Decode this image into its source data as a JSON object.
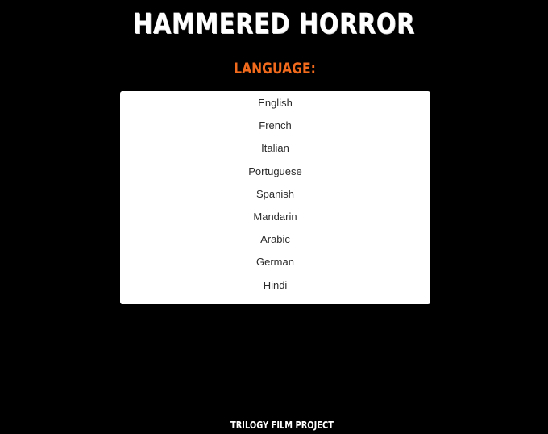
{
  "header": {
    "title": "Hammered Horror"
  },
  "language_section": {
    "label": "Language:",
    "options": [
      "English",
      "French",
      "Italian",
      "Portuguese",
      "Spanish",
      "Mandarin",
      "Arabic",
      "German",
      "Hindi"
    ]
  },
  "footer": {
    "text": "Trilogy Film Project"
  },
  "colors": {
    "background": "#000000",
    "accent": "#f26b1d",
    "title": "#ffffff",
    "list_background": "#ffffff"
  }
}
